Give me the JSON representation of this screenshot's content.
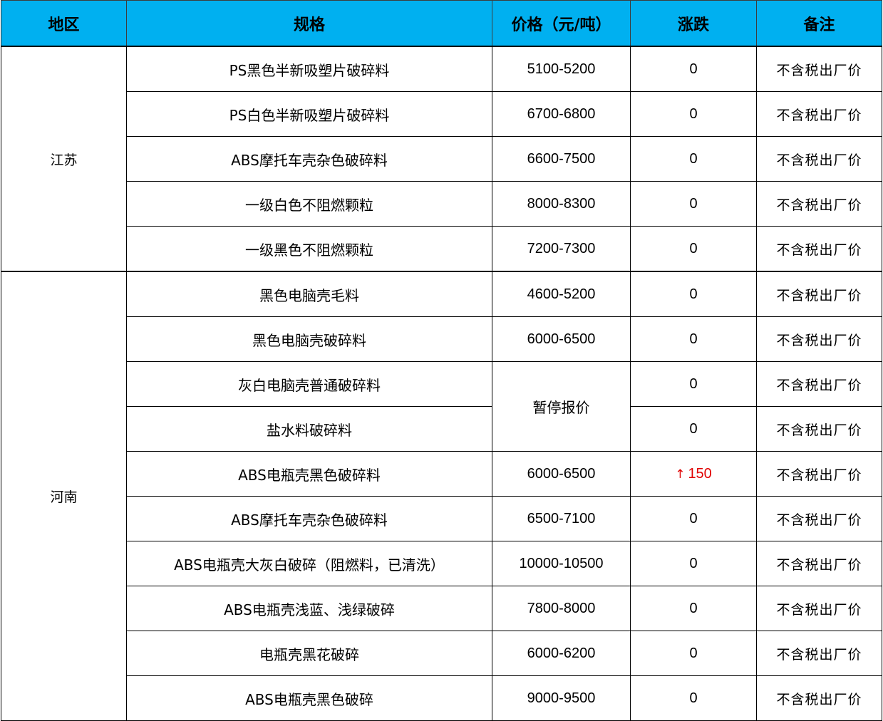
{
  "table": {
    "headers": {
      "region": "地区",
      "spec": "规格",
      "price": "价格（元/吨）",
      "change": "涨跌",
      "note": "备注"
    },
    "groups": [
      {
        "region": "江苏",
        "rows": [
          {
            "spec": "PS黑色半新吸塑片破碎料",
            "price": "5100-5200",
            "change": "0",
            "note": "不含税出厂价"
          },
          {
            "spec": "PS白色半新吸塑片破碎料",
            "price": "6700-6800",
            "change": "0",
            "note": "不含税出厂价"
          },
          {
            "spec": "ABS摩托车壳杂色破碎料",
            "price": "6600-7500",
            "change": "0",
            "note": "不含税出厂价"
          },
          {
            "spec": "一级白色不阻燃颗粒",
            "price": "8000-8300",
            "change": "0",
            "note": "不含税出厂价"
          },
          {
            "spec": "一级黑色不阻燃颗粒",
            "price": "7200-7300",
            "change": "0",
            "note": "不含税出厂价"
          }
        ]
      },
      {
        "region": "河南",
        "rows": [
          {
            "spec": "黑色电脑壳毛料",
            "price": "4600-5200",
            "change": "0",
            "note": "不含税出厂价"
          },
          {
            "spec": "黑色电脑壳破碎料",
            "price": "6000-6500",
            "change": "0",
            "note": "不含税出厂价"
          },
          {
            "spec": "灰白电脑壳普通破碎料",
            "price": "暂停报价",
            "change": "0",
            "note": "不含税出厂价"
          },
          {
            "spec": "盐水料破碎料",
            "price": "暂停报价",
            "change": "0",
            "note": "不含税出厂价"
          },
          {
            "spec": "ABS电瓶壳黑色破碎料",
            "price": "6000-6500",
            "change": "150",
            "change_direction": "up",
            "change_arrow": "↑",
            "change_color": "#e00000",
            "note": "不含税出厂价"
          },
          {
            "spec": "ABS摩托车壳杂色破碎料",
            "price": "6500-7100",
            "change": "0",
            "note": "不含税出厂价"
          },
          {
            "spec": "ABS电瓶壳大灰白破碎（阻燃料，已清洗）",
            "price": "10000-10500",
            "change": "0",
            "note": "不含税出厂价"
          },
          {
            "spec": "ABS电瓶壳浅蓝、浅绿破碎",
            "price": "7800-8000",
            "change": "0",
            "note": "不含税出厂价"
          },
          {
            "spec": "电瓶壳黑花破碎",
            "price": "6000-6200",
            "change": "0",
            "note": "不含税出厂价"
          },
          {
            "spec": "ABS电瓶壳黑色破碎",
            "price": "9000-9500",
            "change": "0",
            "note": "不含税出厂价"
          }
        ]
      }
    ]
  },
  "colors": {
    "header_background": "#00b0f0",
    "price_increase": "#e00000",
    "border": "#000000"
  }
}
